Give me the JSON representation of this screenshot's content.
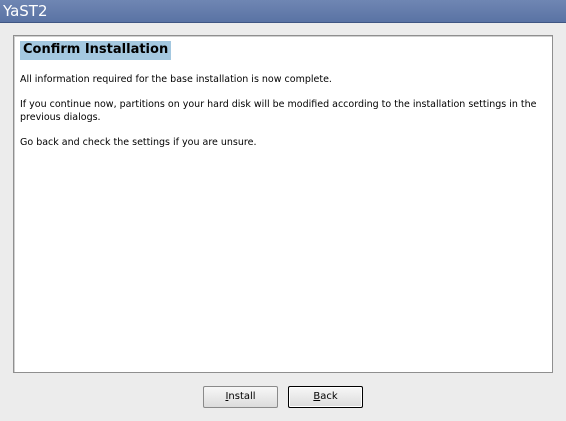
{
  "window": {
    "title": "YaST2"
  },
  "dialog": {
    "heading": "Confirm Installation",
    "paragraphs": [
      "All information required for the base installation is now complete.",
      "If you continue now, partitions on your hard disk will be modified according to the installation settings in the previous dialogs.",
      "Go back and check the settings if you are unsure."
    ]
  },
  "buttons": {
    "install_label": "Install",
    "back_label": "Back"
  },
  "colors": {
    "titlebar": "#5a73a4",
    "heading_highlight": "#a4c8e0"
  }
}
